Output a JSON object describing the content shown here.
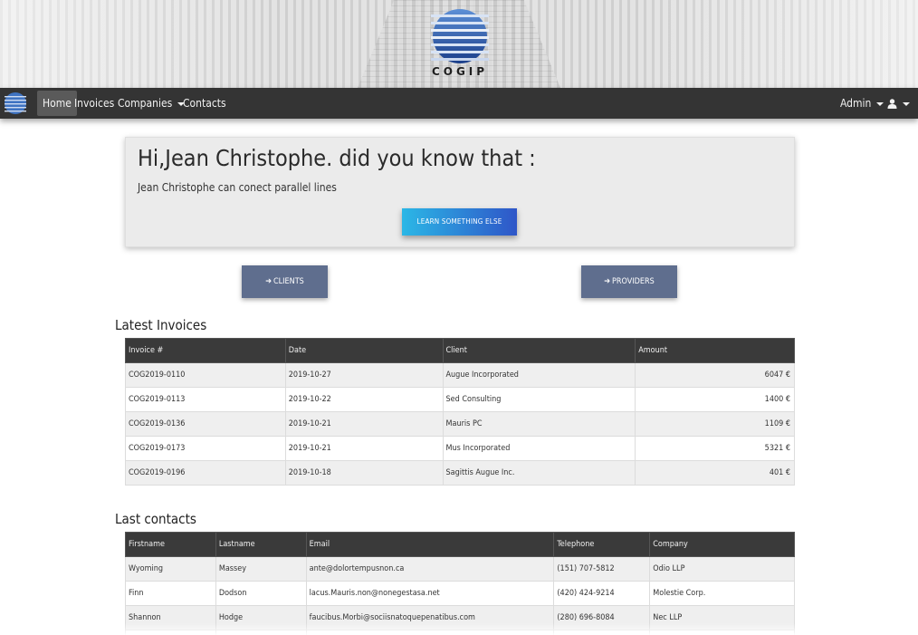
{
  "brand": {
    "name": "COGIP"
  },
  "nav": {
    "items": [
      {
        "label": "Home",
        "active": true
      },
      {
        "label": "Invoices"
      },
      {
        "label": "Companies",
        "dropdown": true
      },
      {
        "label": "Contacts"
      }
    ],
    "admin_label": "Admin",
    "user_icon": "user-icon"
  },
  "jumbotron": {
    "title": "Hi,Jean Christophe. did you know that :",
    "text": "Jean Christophe can conect parallel lines",
    "button_label": "LEARN SOMETHING ELSE"
  },
  "actions": {
    "clients_label": "CLIENTS",
    "providers_label": "PROVIDERS",
    "arrow_icon": "arrow-right-icon"
  },
  "invoices": {
    "title": "Latest Invoices",
    "columns": [
      "Invoice #",
      "Date",
      "Client",
      "Amount"
    ],
    "rows": [
      [
        "COG2019-0110",
        "2019-10-27",
        "Augue Incorporated",
        "6047 €"
      ],
      [
        "COG2019-0113",
        "2019-10-22",
        "Sed Consulting",
        "1400 €"
      ],
      [
        "COG2019-0136",
        "2019-10-21",
        "Mauris PC",
        "1109 €"
      ],
      [
        "COG2019-0173",
        "2019-10-21",
        "Mus Incorporated",
        "5321 €"
      ],
      [
        "COG2019-0196",
        "2019-10-18",
        "Sagittis Augue Inc.",
        "401 €"
      ]
    ]
  },
  "contacts": {
    "title": "Last contacts",
    "columns": [
      "Firstname",
      "Lastname",
      "Email",
      "Telephone",
      "Company"
    ],
    "rows": [
      [
        "Wyoming",
        "Massey",
        "ante@dolortempusnon.ca",
        "(151) 707-5812",
        "Odio LLP"
      ],
      [
        "Finn",
        "Dodson",
        "lacus.Mauris.non@nonegestasa.net",
        "(420) 424-9214",
        "Molestie Corp."
      ],
      [
        "Shannon",
        "Hodge",
        "faucibus.Morbi@sociisnatoquepenatibus.com",
        "(280) 696-8084",
        "Nec LLP"
      ],
      [
        "",
        "",
        "",
        "",
        ""
      ]
    ]
  },
  "colors": {
    "navbar": "#343434",
    "jumbotron_bg": "#ebebeb",
    "learn_btn_start": "#2bb7e6",
    "learn_btn_end": "#2f56c8",
    "action_btn": "#5f6e8e",
    "table_header": "#3a3a3a"
  }
}
